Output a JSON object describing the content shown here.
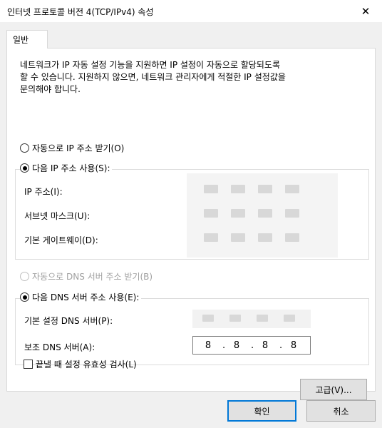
{
  "window": {
    "title": "인터넷 프로토콜 버전 4(TCP/IPv4) 속성"
  },
  "tabs": [
    {
      "label": "일반"
    }
  ],
  "description": [
    "네트워크가 IP 자동 설정 기능을 지원하면 IP 설정이 자동으로 할당되도록",
    "할 수 있습니다. 지원하지 않으면, 네트워크 관리자에게 적절한 IP 설정값을",
    "문의해야 합니다."
  ],
  "ip_section": {
    "auto_label": "자동으로 IP 주소 받기(O)",
    "manual_label": "다음 IP 주소 사용(S):",
    "selected": "manual",
    "fields": [
      {
        "label": "IP 주소(I):",
        "value": ""
      },
      {
        "label": "서브넷 마스크(U):",
        "value": ""
      },
      {
        "label": "기본 게이트웨이(D):",
        "value": ""
      }
    ]
  },
  "dns_section": {
    "auto_label": "자동으로 DNS 서버 주소 받기(B)",
    "manual_label": "다음 DNS 서버 주소 사용(E):",
    "selected": "manual",
    "preferred": {
      "label": "기본 설정 DNS 서버(P):",
      "value": ""
    },
    "alternate": {
      "label": "보조 DNS 서버(A):",
      "octets": [
        "8",
        "8",
        "8",
        "8"
      ]
    }
  },
  "validate_checkbox": {
    "label": "끝낼 때 설정 유효성 검사(L)",
    "checked": false
  },
  "buttons": {
    "advanced": "고급(V)...",
    "ok": "확인",
    "cancel": "취소"
  },
  "close_glyph": "✕"
}
